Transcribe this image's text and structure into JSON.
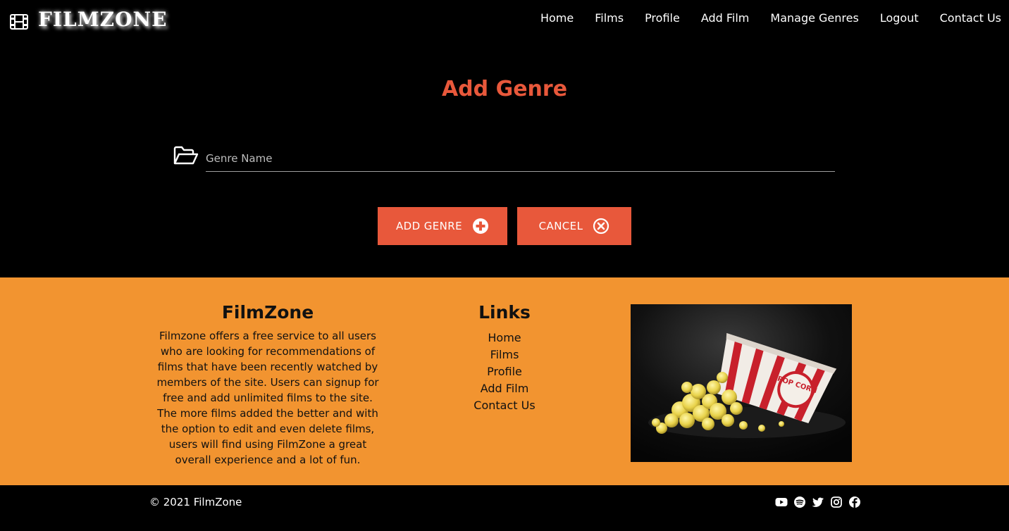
{
  "nav": {
    "brand": "FILMZONE",
    "brand_icon": "film-icon",
    "links": [
      "Home",
      "Films",
      "Profile",
      "Add Film",
      "Manage Genres",
      "Logout",
      "Contact Us"
    ]
  },
  "main": {
    "title": "Add Genre",
    "field": {
      "icon": "folder-open-icon",
      "placeholder": "Genre Name",
      "value": ""
    },
    "buttons": {
      "add": {
        "label": "Add Genre",
        "icon": "plus-circle-icon"
      },
      "cancel": {
        "label": "Cancel",
        "icon": "times-circle-icon"
      }
    }
  },
  "footer": {
    "about": {
      "title": "FilmZone",
      "text": "Filmzone offers a free service to all users who are looking for recommendations of films that have been recently watched by members of the site. Users can signup for free and add unlimited films to the site. The more films added the better and with the option to edit and even delete films, users will find using FilmZone a great overall experience and a lot of fun."
    },
    "links": {
      "title": "Links",
      "items": [
        "Home",
        "Films",
        "Profile",
        "Add Film",
        "Contact Us"
      ]
    },
    "image": {
      "subject": "popcorn box spilling popcorn",
      "box_text": "POP CORN"
    },
    "copyright": "© 2021 FilmZone",
    "socials": [
      "youtube-icon",
      "spotify-icon",
      "twitter-icon",
      "instagram-icon",
      "facebook-icon"
    ]
  },
  "colors": {
    "accent": "#e8583b",
    "footer_bg": "#f29430",
    "page_bg": "#000000",
    "text_light": "#ffffff",
    "text_dark": "#111111"
  }
}
